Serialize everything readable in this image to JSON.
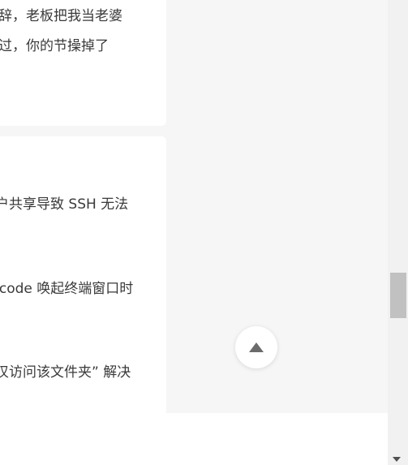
{
  "articles_top": {
    "line1": "辞，老板把我当老婆",
    "line2": "过，你的节操掉了"
  },
  "articles_list": [
    {
      "text": "户共享导致 SSH 无法"
    },
    {
      "text": "scode 唤起终端窗口时",
      "continuation": "."
    },
    {
      "text": "叹访问该文件夹” 解决"
    }
  ],
  "icons": {
    "back_to_top": "arrow-up-icon",
    "scroll_down": "scroll-down-arrow-icon"
  },
  "colors": {
    "page_bg": "#f6f6f6",
    "card_bg": "#ffffff",
    "icon": "#6b6b6b"
  }
}
